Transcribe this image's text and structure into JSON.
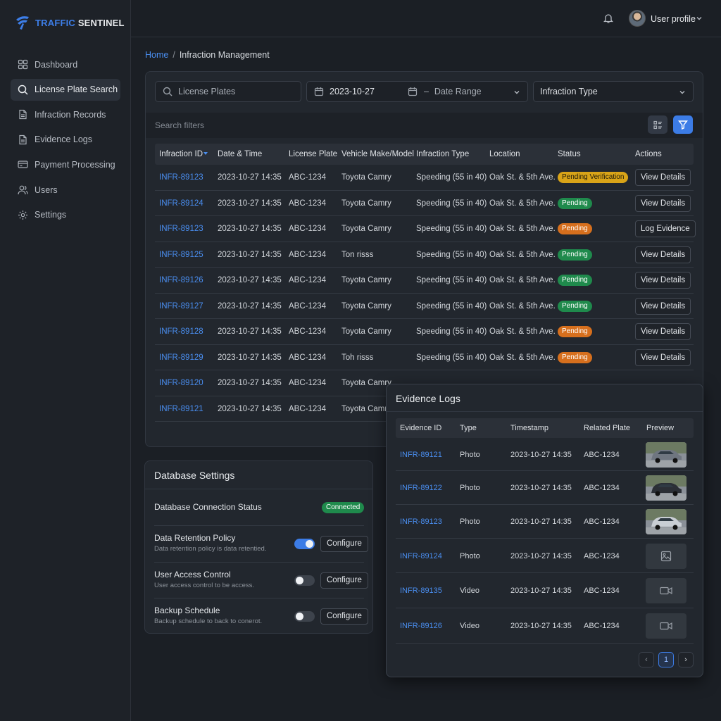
{
  "brand": {
    "name_part1": "TRAFFIC",
    "name_part2": "SENTINEL"
  },
  "sidebar": {
    "items": [
      {
        "label": "Dashboard",
        "icon": "grid-icon",
        "active": false
      },
      {
        "label": "License Plate Search",
        "icon": "search-icon",
        "active": true
      },
      {
        "label": "Infraction Records",
        "icon": "document-icon",
        "active": false
      },
      {
        "label": "Evidence Logs",
        "icon": "document-icon",
        "active": false
      },
      {
        "label": "Payment Processing",
        "icon": "credit-card-icon",
        "active": false
      },
      {
        "label": "Users",
        "icon": "users-icon",
        "active": false
      },
      {
        "label": "Settings",
        "icon": "gear-icon",
        "active": false
      }
    ]
  },
  "topbar": {
    "profile_label": "User profile"
  },
  "breadcrumb": {
    "home": "Home",
    "separator": "/",
    "current": "Infraction Management"
  },
  "search": {
    "plate_placeholder": "License Plates",
    "date_value": "2023-10-27",
    "date_sep": "–",
    "range_placeholder": "Date Range",
    "type_placeholder": "Infraction Type",
    "filters_label": "Search filters"
  },
  "table": {
    "columns": [
      "Infraction ID",
      "Date & Time",
      "License Plate",
      "Vehicle Make/Model",
      "Infraction Type",
      "Location",
      "Status",
      "Actions"
    ],
    "rows": [
      {
        "id": "INFR-89123",
        "datetime": "2023-10-27 14:35",
        "plate": "ABC-1234",
        "vehicle": "Toyota Camry",
        "type": "Speeding (55 in 40)",
        "location": "Oak St. & 5th Ave.",
        "status": "Pending Verification",
        "status_color": "yellow",
        "action": "View Details"
      },
      {
        "id": "INFR-89124",
        "datetime": "2023-10-27 14:35",
        "plate": "ABC-1234",
        "vehicle": "Toyota Camry",
        "type": "Speeding (55 in 40)",
        "location": "Oak St. & 5th Ave.",
        "status": "Pending",
        "status_color": "green",
        "action": "View Details"
      },
      {
        "id": "INFR-89123",
        "datetime": "2023-10-27 14:35",
        "plate": "ABC-1234",
        "vehicle": "Toyota Camry",
        "type": "Speeding (55 in 40)",
        "location": "Oak St. & 5th Ave.",
        "status": "Pending",
        "status_color": "orange",
        "action": "Log Evidence"
      },
      {
        "id": "INFR-89125",
        "datetime": "2023-10-27 14:35",
        "plate": "ABC-1234",
        "vehicle": "Ton risss",
        "type": "Speeding (55 in 40)",
        "location": "Oak St. & 5th Ave.",
        "status": "Pending",
        "status_color": "green",
        "action": "View Details"
      },
      {
        "id": "INFR-89126",
        "datetime": "2023-10-27 14:35",
        "plate": "ABC-1234",
        "vehicle": "Toyota Camry",
        "type": "Speeding (55 in 40)",
        "location": "Oak St. & 5th Ave.",
        "status": "Pending",
        "status_color": "green",
        "action": "View Details"
      },
      {
        "id": "INFR-89127",
        "datetime": "2023-10-27 14:35",
        "plate": "ABC-1234",
        "vehicle": "Toyota Camry",
        "type": "Speeding (55 in 40)",
        "location": "Oak St. & 5th Ave.",
        "status": "Pending",
        "status_color": "green",
        "action": "View Details"
      },
      {
        "id": "INFR-89128",
        "datetime": "2023-10-27 14:35",
        "plate": "ABC-1234",
        "vehicle": "Toyota Camry",
        "type": "Speeding (55 in 40)",
        "location": "Oak St. & 5th Ave.",
        "status": "Pending",
        "status_color": "orange",
        "action": "View Details"
      },
      {
        "id": "INFR-89129",
        "datetime": "2023-10-27 14:35",
        "plate": "ABC-1234",
        "vehicle": "Toh risss",
        "type": "Speeding (55 in 40)",
        "location": "Oak St. & 5th Ave.",
        "status": "Pending",
        "status_color": "orange",
        "action": "View Details"
      },
      {
        "id": "INFR-89120",
        "datetime": "2023-10-27 14:35",
        "plate": "ABC-1234",
        "vehicle": "Toyota Camry",
        "type": "",
        "location": "",
        "status": "",
        "status_color": "",
        "action": ""
      },
      {
        "id": "INFR-89121",
        "datetime": "2023-10-27 14:35",
        "plate": "ABC-1234",
        "vehicle": "Toyota Camry",
        "type": "",
        "location": "",
        "status": "",
        "status_color": "",
        "action": ""
      }
    ]
  },
  "db_settings": {
    "title": "Database Settings",
    "connection_label": "Database Connection Status",
    "connection_status": "Connected",
    "configure_label": "Configure",
    "items": [
      {
        "label": "Data Retention Policy",
        "sub": "Data retention policy is data retentied.",
        "enabled": true
      },
      {
        "label": "User Access Control",
        "sub": "User access control to be access.",
        "enabled": false
      },
      {
        "label": "Backup Schedule",
        "sub": "Backup schedule to back to conerot.",
        "enabled": false
      }
    ]
  },
  "evidence": {
    "title": "Evidence Logs",
    "columns": [
      "Evidence ID",
      "Type",
      "Timestamp",
      "Related Plate",
      "Preview"
    ],
    "rows": [
      {
        "id": "INFR-89121",
        "type": "Photo",
        "timestamp": "2023-10-27 14:35",
        "plate": "ABC-1234",
        "preview": "photo-thumbnail"
      },
      {
        "id": "INFR-89122",
        "type": "Photo",
        "timestamp": "2023-10-27 14:35",
        "plate": "ABC-1234",
        "preview": "photo-thumbnail"
      },
      {
        "id": "INFR-89123",
        "type": "Photo",
        "timestamp": "2023-10-27 14:35",
        "plate": "ABC-1234",
        "preview": "photo-thumbnail"
      },
      {
        "id": "INFR-89124",
        "type": "Photo",
        "timestamp": "2023-10-27 14:35",
        "plate": "ABC-1234",
        "preview": "image-placeholder-icon"
      },
      {
        "id": "INFR-89135",
        "type": "Video",
        "timestamp": "2023-10-27 14:35",
        "plate": "ABC-1234",
        "preview": "video-camera-icon"
      },
      {
        "id": "INFR-89126",
        "type": "Video",
        "timestamp": "2023-10-27 14:35",
        "plate": "ABC-1234",
        "preview": "video-camera-icon"
      }
    ],
    "pagination": {
      "current_page": "1",
      "prev": "‹",
      "next": "›"
    }
  },
  "colors": {
    "accent": "#3c7ce6",
    "link": "#4a8ef0",
    "pending_verification": "#d9a418",
    "pending_green": "#1f8a4c",
    "pending_orange": "#d66f1d"
  }
}
